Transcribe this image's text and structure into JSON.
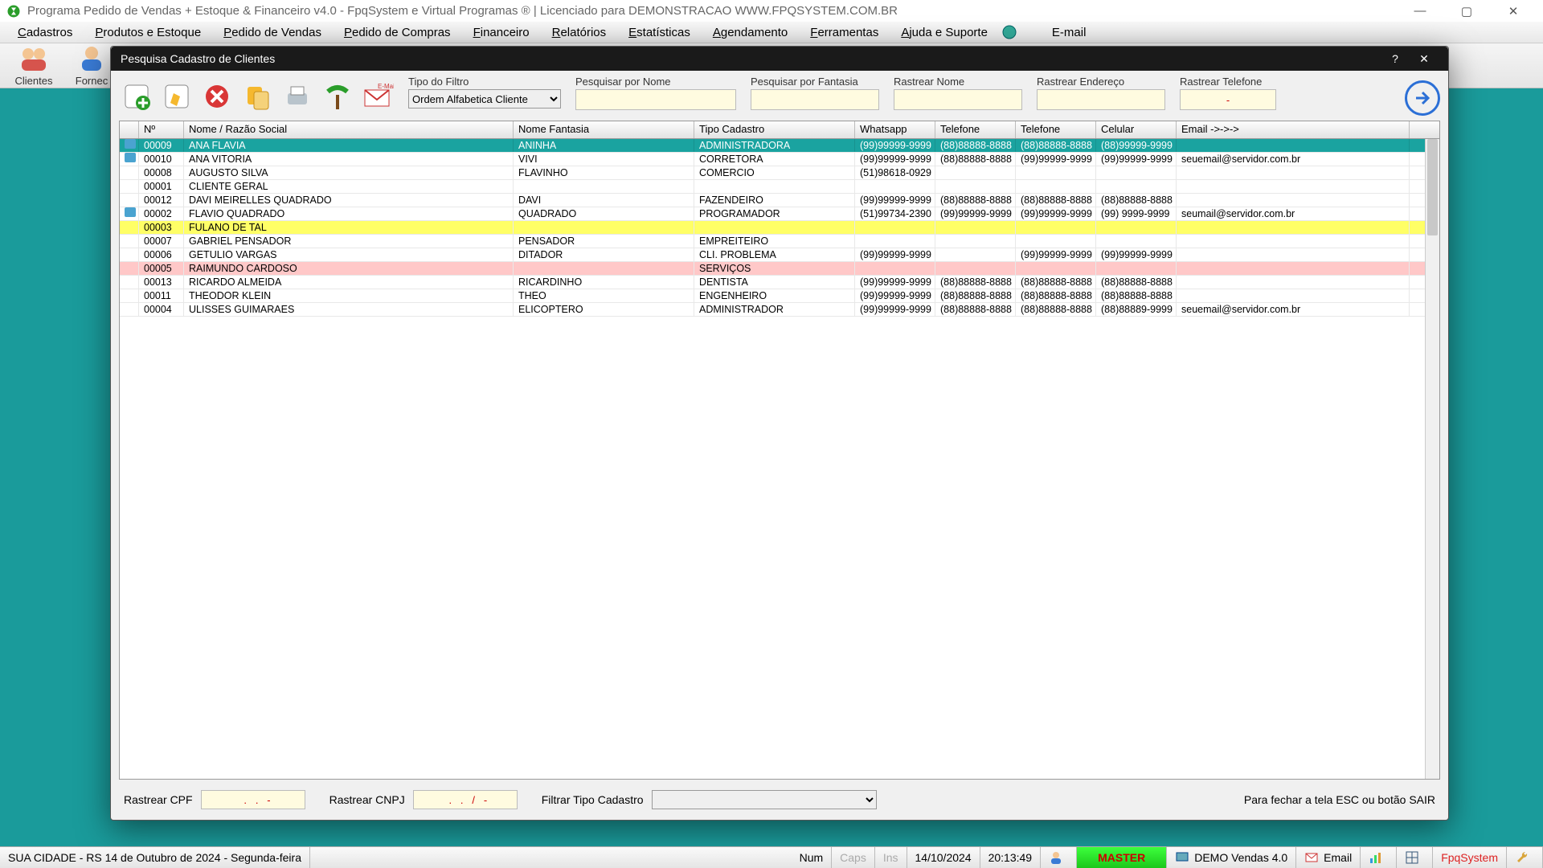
{
  "window": {
    "title": "Programa Pedido de Vendas + Estoque & Financeiro v4.0 - FpqSystem e Virtual Programas ® | Licenciado para  DEMONSTRACAO WWW.FPQSYSTEM.COM.BR"
  },
  "menu": {
    "cadastros": "Cadastros",
    "produtos": "Produtos e Estoque",
    "pedido_vendas": "Pedido de Vendas",
    "pedido_compras": "Pedido de Compras",
    "financeiro": "Financeiro",
    "relatorios": "Relatórios",
    "estatisticas": "Estatísticas",
    "agendamento": "Agendamento",
    "ferramentas": "Ferramentas",
    "ajuda": "Ajuda e Suporte",
    "email": "E-mail"
  },
  "maintb": {
    "clientes": "Clientes",
    "fornec": "Fornec"
  },
  "modal": {
    "title": "Pesquisa Cadastro de Clientes",
    "tipo_filtro_label": "Tipo do Filtro",
    "tipo_filtro_value": "Ordem Alfabetica Cliente",
    "pesq_nome": "Pesquisar por Nome",
    "pesq_fantasia": "Pesquisar por Fantasia",
    "rast_nome": "Rastrear Nome",
    "rast_endereco": "Rastrear Endereço",
    "rast_telefone": "Rastrear Telefone",
    "rast_telefone_value": "-",
    "rast_cpf_label": "Rastrear CPF",
    "rast_cpf_value": "   .   .   -",
    "rast_cnpj_label": "Rastrear CNPJ",
    "rast_cnpj_value": "  .   .   /   -",
    "filtrar_tipo_label": "Filtrar Tipo Cadastro",
    "hint": "Para fechar a tela ESC ou botão SAIR"
  },
  "columns": {
    "num": "Nº",
    "nome": "Nome / Razão Social",
    "fantasia": "Nome Fantasia",
    "tipo": "Tipo Cadastro",
    "whatsapp": "Whatsapp",
    "tel1": "Telefone",
    "tel2": "Telefone",
    "celular": "Celular",
    "email": "Email ->->->"
  },
  "rows": [
    {
      "exp": true,
      "num": "00009",
      "nome": "ANA FLAVIA",
      "fant": "ANINHA",
      "tipo": "ADMINISTRADORA",
      "wa": "(99)99999-9999",
      "t1": "(88)88888-8888",
      "t2": "(88)88888-8888",
      "cel": "(88)99999-9999",
      "email": "",
      "cls": "selected"
    },
    {
      "exp": true,
      "num": "00010",
      "nome": "ANA VITORIA",
      "fant": "VIVI",
      "tipo": "CORRETORA",
      "wa": "(99)99999-9999",
      "t1": "(88)88888-8888",
      "t2": "(99)99999-9999",
      "cel": "(99)99999-9999",
      "email": "seuemail@servidor.com.br",
      "cls": ""
    },
    {
      "exp": false,
      "num": "00008",
      "nome": "AUGUSTO SILVA",
      "fant": "FLAVINHO",
      "tipo": "COMERCIO",
      "wa": "(51)98618-0929",
      "t1": "",
      "t2": "",
      "cel": "",
      "email": "",
      "cls": ""
    },
    {
      "exp": false,
      "num": "00001",
      "nome": "CLIENTE GERAL",
      "fant": "",
      "tipo": "",
      "wa": "",
      "t1": "",
      "t2": "",
      "cel": "",
      "email": "",
      "cls": ""
    },
    {
      "exp": false,
      "num": "00012",
      "nome": "DAVI MEIRELLES QUADRADO",
      "fant": "DAVI",
      "tipo": "FAZENDEIRO",
      "wa": "(99)99999-9999",
      "t1": "(88)88888-8888",
      "t2": "(88)88888-8888",
      "cel": "(88)88888-8888",
      "email": "",
      "cls": ""
    },
    {
      "exp": true,
      "num": "00002",
      "nome": "FLAVIO QUADRADO",
      "fant": "QUADRADO",
      "tipo": "PROGRAMADOR",
      "wa": "(51)99734-2390",
      "t1": "(99)99999-9999",
      "t2": "(99)99999-9999",
      "cel": "(99) 9999-9999",
      "email": "seumail@servidor.com.br",
      "cls": ""
    },
    {
      "exp": false,
      "num": "00003",
      "nome": "FULANO DE TAL",
      "fant": "",
      "tipo": "",
      "wa": "",
      "t1": "",
      "t2": "",
      "cel": "",
      "email": "",
      "cls": "yellow"
    },
    {
      "exp": false,
      "num": "00007",
      "nome": "GABRIEL PENSADOR",
      "fant": "PENSADOR",
      "tipo": "EMPREITEIRO",
      "wa": "",
      "t1": "",
      "t2": "",
      "cel": "",
      "email": "",
      "cls": ""
    },
    {
      "exp": false,
      "num": "00006",
      "nome": "GETULIO VARGAS",
      "fant": "DITADOR",
      "tipo": "CLI. PROBLEMA",
      "wa": "(99)99999-9999",
      "t1": "",
      "t2": "(99)99999-9999",
      "cel": "(99)99999-9999",
      "email": "",
      "cls": ""
    },
    {
      "exp": false,
      "num": "00005",
      "nome": "RAIMUNDO CARDOSO",
      "fant": "",
      "tipo": "SERVIÇOS",
      "wa": "",
      "t1": "",
      "t2": "",
      "cel": "",
      "email": "",
      "cls": "pink"
    },
    {
      "exp": false,
      "num": "00013",
      "nome": "RICARDO ALMEIDA",
      "fant": "RICARDINHO",
      "tipo": "DENTISTA",
      "wa": "(99)99999-9999",
      "t1": "(88)88888-8888",
      "t2": "(88)88888-8888",
      "cel": "(88)88888-8888",
      "email": "",
      "cls": ""
    },
    {
      "exp": false,
      "num": "00011",
      "nome": "THEODOR KLEIN",
      "fant": "THEO",
      "tipo": "ENGENHEIRO",
      "wa": "(99)99999-9999",
      "t1": "(88)88888-8888",
      "t2": "(88)88888-8888",
      "cel": "(88)88888-8888",
      "email": "",
      "cls": ""
    },
    {
      "exp": false,
      "num": "00004",
      "nome": "ULISSES GUIMARAES",
      "fant": "ELICOPTERO",
      "tipo": "ADMINISTRADOR",
      "wa": "(99)99999-9999",
      "t1": "(88)88888-8888",
      "t2": "(88)88888-8888",
      "cel": "(88)88889-9999",
      "email": "seuemail@servidor.com.br",
      "cls": ""
    }
  ],
  "status": {
    "city": "SUA CIDADE - RS 14 de Outubro de 2024 - Segunda-feira",
    "num": "Num",
    "caps": "Caps",
    "ins": "Ins",
    "date": "14/10/2024",
    "time": "20:13:49",
    "master": "MASTER",
    "demo": "DEMO Vendas 4.0",
    "email": "Email",
    "fpq": "FpqSystem"
  }
}
